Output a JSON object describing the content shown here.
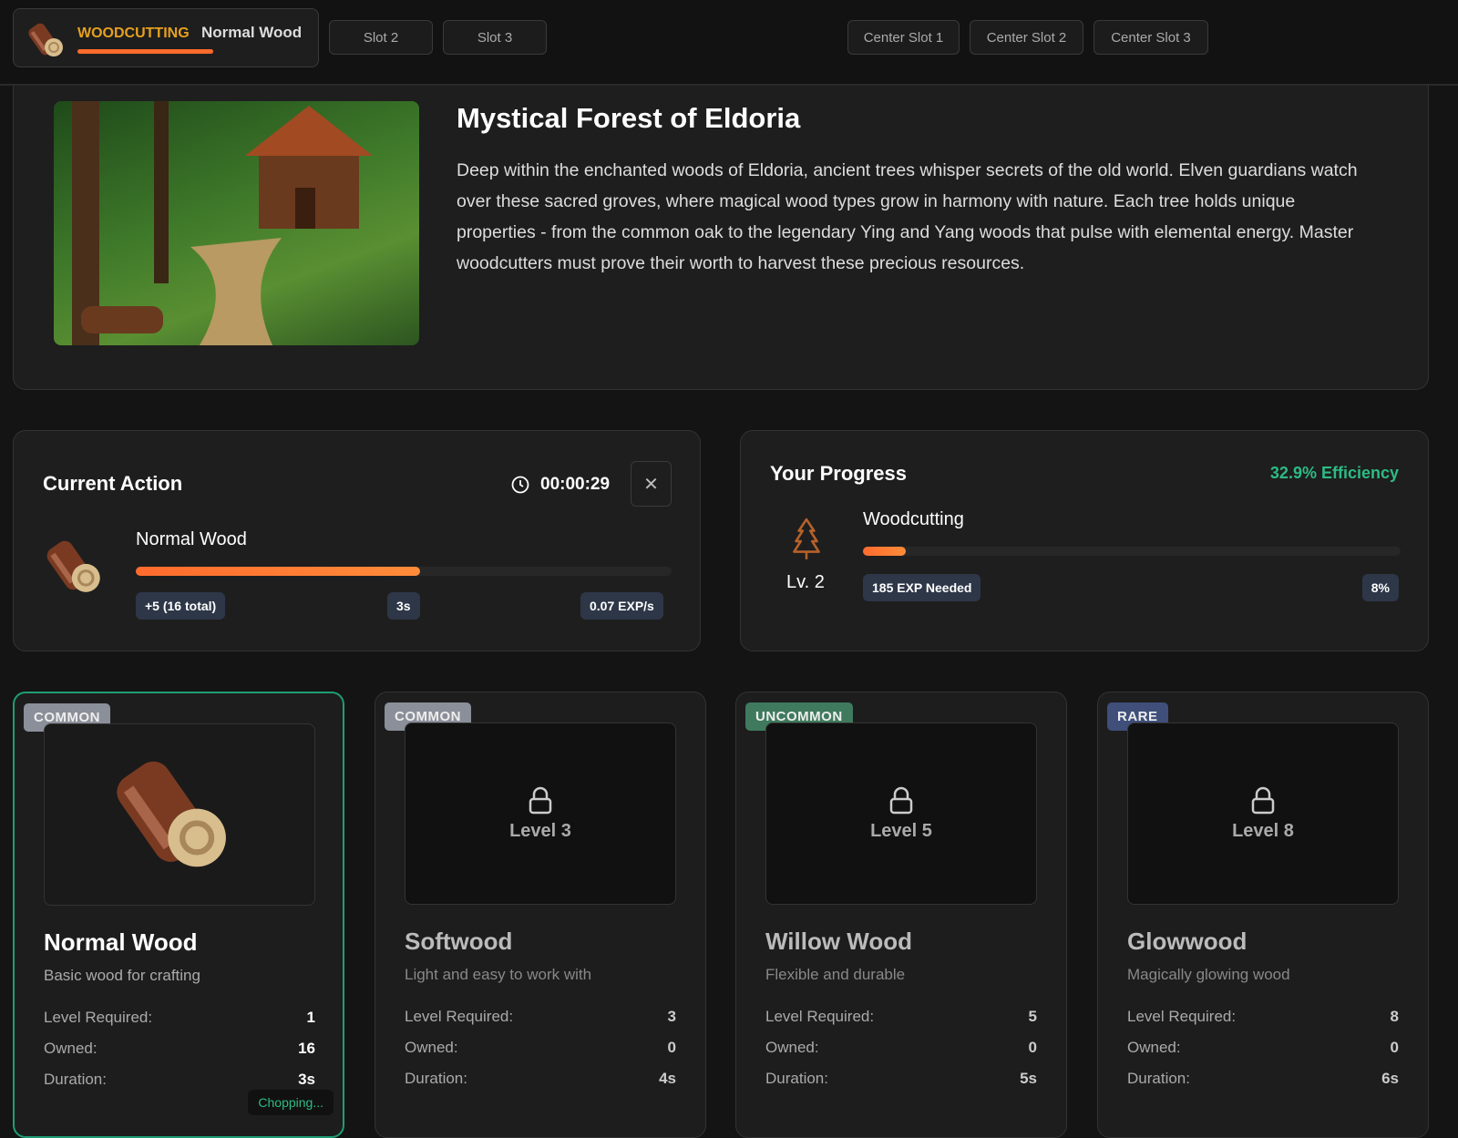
{
  "topbar": {
    "active_slot": {
      "skill": "WOODCUTTING",
      "resource": "Normal Wood",
      "progress": 0.55
    },
    "slots": [
      "Slot 2",
      "Slot 3"
    ],
    "center_slots": [
      "Center Slot 1",
      "Center Slot 2",
      "Center Slot 3"
    ]
  },
  "hero": {
    "title": "Mystical Forest of Eldoria",
    "description": "Deep within the enchanted woods of Eldoria, ancient trees whisper secrets of the old world. Elven guardians watch over these sacred groves, where magical wood types grow in harmony with nature. Each tree holds unique properties - from the common oak to the legendary Ying and Yang woods that pulse with elemental energy. Master woodcutters must prove their worth to harvest these precious resources."
  },
  "current_action": {
    "title": "Current Action",
    "timer": "00:00:29",
    "resource": "Normal Wood",
    "progress": 0.53,
    "yield": "+5 (16 total)",
    "duration": "3s",
    "exp_rate": "0.07 EXP/s"
  },
  "progress": {
    "title": "Your Progress",
    "efficiency": "32.9% Efficiency",
    "skill": "Woodcutting",
    "level": "Lv. 2",
    "exp_needed": "185 EXP Needed",
    "percent": "8%",
    "fraction": 0.08
  },
  "labels": {
    "level_required": "Level Required:",
    "owned": "Owned:",
    "duration": "Duration:",
    "chopping": "Chopping..."
  },
  "items": [
    {
      "rarity": "COMMON",
      "name": "Normal Wood",
      "desc": "Basic wood for crafting",
      "level": "1",
      "owned": "16",
      "duration": "3s"
    },
    {
      "rarity": "COMMON",
      "name": "Softwood",
      "desc": "Light and easy to work with",
      "level": "3",
      "owned": "0",
      "duration": "4s",
      "lock": "Level 3"
    },
    {
      "rarity": "UNCOMMON",
      "name": "Willow Wood",
      "desc": "Flexible and durable",
      "level": "5",
      "owned": "0",
      "duration": "5s",
      "lock": "Level 5"
    },
    {
      "rarity": "RARE",
      "name": "Glowwood",
      "desc": "Magically glowing wood",
      "level": "8",
      "owned": "0",
      "duration": "6s",
      "lock": "Level 8"
    }
  ],
  "colors": {
    "accent": "#ff6b2d",
    "green": "#2dbb85",
    "common": "#8a8f99",
    "uncommon": "#3f7a5e",
    "rare": "#3f4f7a"
  }
}
